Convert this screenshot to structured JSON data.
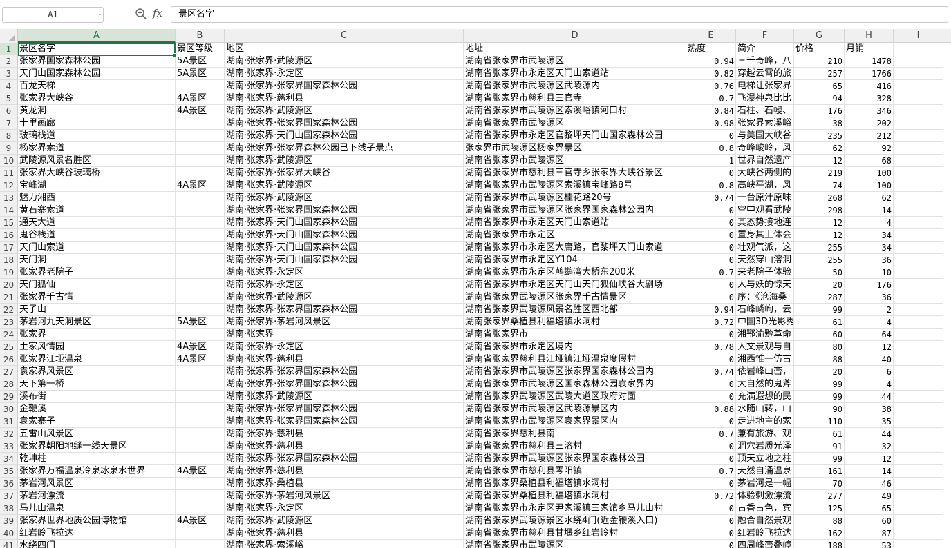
{
  "name_box": "A1",
  "formula_bar": {
    "fx_label": "fx",
    "value": "景区名字"
  },
  "columns": [
    "A",
    "B",
    "C",
    "D",
    "E",
    "F",
    "G",
    "H",
    "I"
  ],
  "selected_column": "A",
  "rows": [
    {
      "n": "1",
      "a": "景区名字",
      "b": "景区等级",
      "c": "地区",
      "d": "地址",
      "e": "热度",
      "f": "简介",
      "g": "价格",
      "h": "月销"
    },
    {
      "n": "2",
      "a": "张家界国家森林公园",
      "b": "5A景区",
      "c": "湖南·张家界·武陵源区",
      "d": "湖南省张家界市武陵源区",
      "e": "0.94",
      "f": "三千奇峰，八",
      "g": "210",
      "h": "1478"
    },
    {
      "n": "3",
      "a": "天门山国家森林公园",
      "b": "5A景区",
      "c": "湖南·张家界·永定区",
      "d": "湖南省张家界市永定区天门山索道站",
      "e": "0.82",
      "f": "穿越云霄的旅",
      "g": "257",
      "h": "1766"
    },
    {
      "n": "4",
      "a": "百龙天梯",
      "b": "",
      "c": "湖南·张家界·张家界国家森林公园",
      "d": "湖南省张家界市武陵源区武陵源内",
      "e": "0.76",
      "f": "电梯让张家界",
      "g": "65",
      "h": "416"
    },
    {
      "n": "5",
      "a": "张家界大峡谷",
      "b": "4A景区",
      "c": "湖南·张家界·慈利县",
      "d": "湖南省张家界市慈利县三官寺",
      "e": "0.7",
      "f": "飞瀑神泉比比",
      "g": "94",
      "h": "328"
    },
    {
      "n": "6",
      "a": "黄龙洞",
      "b": "4A景区",
      "c": "湖南·张家界·武陵源区",
      "d": "湖南省张家界市武陵源区索溪峪镇河口村",
      "e": "0.84",
      "f": "石柱、石幔、",
      "g": "176",
      "h": "346"
    },
    {
      "n": "7",
      "a": "十里画廊",
      "b": "",
      "c": "湖南·张家界·张家界国家森林公园",
      "d": "湖南省张家界市武陵源区",
      "e": "0.98",
      "f": "张家界索溪峪",
      "g": "38",
      "h": "202"
    },
    {
      "n": "8",
      "a": "玻璃栈道",
      "b": "",
      "c": "湖南·张家界·天门山国家森林公园",
      "d": "湖南省张家界市永定区官黎坪天门山国家森林公园",
      "e": "0",
      "f": "与美国大峡谷",
      "g": "235",
      "h": "212"
    },
    {
      "n": "9",
      "a": "杨家界索道",
      "b": "",
      "c": "湖南·张家界·张家界森林公园已下线子景点",
      "d": "张家界市武陵源区杨家界景区",
      "e": "0.8",
      "f": "奇峰峻岭，风",
      "g": "62",
      "h": "92"
    },
    {
      "n": "10",
      "a": "武陵源风景名胜区",
      "b": "",
      "c": "湖南·张家界·武陵源区",
      "d": "湖南省张家界市武陵源区",
      "e": "1",
      "f": "世界自然遗产",
      "g": "12",
      "h": "68"
    },
    {
      "n": "11",
      "a": "张家界大峡谷玻璃桥",
      "b": "",
      "c": "湖南·张家界·张家界大峡谷",
      "d": "湖南省张家界市慈利县三官寺乡张家界大峡谷景区",
      "e": "0",
      "f": "大峡谷两侧的",
      "g": "219",
      "h": "100"
    },
    {
      "n": "12",
      "a": "宝峰湖",
      "b": "4A景区",
      "c": "湖南·张家界·武陵源区",
      "d": "湖南省张家界市武陵源区索溪镇宝峰路8号",
      "e": "0.8",
      "f": "高峡平湖，风",
      "g": "74",
      "h": "100"
    },
    {
      "n": "13",
      "a": "魅力湘西",
      "b": "",
      "c": "湖南·张家界·武陵源区",
      "d": "湖南省张家界市武陵源区桂花路20号",
      "e": "0.74",
      "f": "一台原汁原味",
      "g": "268",
      "h": "62"
    },
    {
      "n": "14",
      "a": "黄石寨索道",
      "b": "",
      "c": "湖南·张家界·张家界国家森林公园",
      "d": "湖南省张家界市武陵源区张家界国家森林公园内",
      "e": "0",
      "f": "空中观看武陵",
      "g": "298",
      "h": "14"
    },
    {
      "n": "15",
      "a": "通天大道",
      "b": "",
      "c": "湖南·张家界·天门山国家森林公园",
      "d": "湖南省张家界市永定区天门山索道站",
      "e": "0",
      "f": "其态势接地连",
      "g": "12",
      "h": "4"
    },
    {
      "n": "16",
      "a": "鬼谷栈道",
      "b": "",
      "c": "湖南·张家界·天门山国家森林公园",
      "d": "湖南省张家界市永定区",
      "e": "0",
      "f": "置身其上体会",
      "g": "12",
      "h": "34"
    },
    {
      "n": "17",
      "a": "天门山索道",
      "b": "",
      "c": "湖南·张家界·天门山国家森林公园",
      "d": "湖南省张家界市永定区大庸路，官黎坪天门山索道",
      "e": "0",
      "f": "壮观气派，这",
      "g": "255",
      "h": "34"
    },
    {
      "n": "18",
      "a": "天门洞",
      "b": "",
      "c": "湖南·张家界·天门山国家森林公园",
      "d": "湖南省张家界市永定区Y104",
      "e": "0",
      "f": "天然穿山溶洞",
      "g": "255",
      "h": "36"
    },
    {
      "n": "19",
      "a": "张家界老院子",
      "b": "",
      "c": "湖南·张家界·永定区",
      "d": "湖南省张家界市永定区鸬鹚湾大桥东200米",
      "e": "0.7",
      "f": "来老院子体验",
      "g": "50",
      "h": "10"
    },
    {
      "n": "20",
      "a": "天门狐仙",
      "b": "",
      "c": "湖南·张家界·永定区",
      "d": "湖南省张家界市永定区天门山天门狐仙峡谷大剧场",
      "e": "0",
      "f": "人与妖的惊天",
      "g": "20",
      "h": "176"
    },
    {
      "n": "21",
      "a": "张家界千古情",
      "b": "",
      "c": "湖南·张家界·武陵源区",
      "d": "湖南省张家界武陵源区张家界千古情景区",
      "e": "0",
      "f": "序：《沧海桑",
      "g": "287",
      "h": "36"
    },
    {
      "n": "22",
      "a": "天子山",
      "b": "",
      "c": "湖南·张家界·张家界国家森林公园",
      "d": "湖南省张家界武陵源风景名胜区西北部",
      "e": "0.94",
      "f": "石峰嶙峋，云",
      "g": "99",
      "h": "2"
    },
    {
      "n": "23",
      "a": "茅岩河九天洞景区",
      "b": "5A景区",
      "c": "湖南·张家界·茅岩河风景区",
      "d": "湖南张家界桑植县利福塔镇水洞村",
      "e": "0.72",
      "f": "中国3D光影秀",
      "g": "61",
      "h": "4"
    },
    {
      "n": "24",
      "a": "张家界",
      "b": "",
      "c": "湖南·张家界",
      "d": "湖南省张家界市",
      "e": "0",
      "f": "湘鄂渝黔革命",
      "g": "60",
      "h": "64"
    },
    {
      "n": "25",
      "a": "土家风情园",
      "b": "4A景区",
      "c": "湖南·张家界·永定区",
      "d": "湖南省张家界市永定区境内",
      "e": "0.78",
      "f": "人文景观与自",
      "g": "80",
      "h": "12"
    },
    {
      "n": "26",
      "a": "张家界江垭温泉",
      "b": "4A景区",
      "c": "湖南·张家界·慈利县",
      "d": "湖南省张家界慈利县江垭镇江垭温泉度假村",
      "e": "0",
      "f": "湘西惟一仿古",
      "g": "88",
      "h": "40"
    },
    {
      "n": "27",
      "a": "袁家界风景区",
      "b": "",
      "c": "湖南·张家界·张家界国家森林公园",
      "d": "湖南省张家界市武陵源区张家界国家森林公园内",
      "e": "0.74",
      "f": "依岩峰山峦，",
      "g": "20",
      "h": "6"
    },
    {
      "n": "28",
      "a": "天下第一桥",
      "b": "",
      "c": "湖南·张家界·张家界国家森林公园",
      "d": "湖南省张家界市武陵源区国家森林公园袁家界内",
      "e": "0",
      "f": "大自然的鬼斧",
      "g": "99",
      "h": "4"
    },
    {
      "n": "29",
      "a": "溪布街",
      "b": "",
      "c": "湖南·张家界·武陵源区",
      "d": "湖南省张家界武陵源区武陵大道区政府对面",
      "e": "0",
      "f": "充满遐想的民",
      "g": "99",
      "h": "44"
    },
    {
      "n": "30",
      "a": "金鞭溪",
      "b": "",
      "c": "湖南·张家界·张家界国家森林公园",
      "d": "湖南省张家界市武陵源区武陵源景区内",
      "e": "0.88",
      "f": "水随山转，山",
      "g": "90",
      "h": "38"
    },
    {
      "n": "31",
      "a": "袁家寨子",
      "b": "",
      "c": "湖南·张家界·张家界国家森林公园",
      "d": "湖南省张家界市武陵源区袁家界景区内",
      "e": "0",
      "f": "走进地主的家",
      "g": "110",
      "h": "35"
    },
    {
      "n": "32",
      "a": "五雷山风景区",
      "b": "",
      "c": "湖南·张家界·慈利县",
      "d": "湖南省张家界慈利县南",
      "e": "0.7",
      "f": "兼有旅游、观",
      "g": "61",
      "h": "44"
    },
    {
      "n": "33",
      "a": "张家界朝阳地缝一线天景区",
      "b": "",
      "c": "湖南·张家界·慈利县",
      "d": "湖南省张家界市慈利县三溶村",
      "e": "0",
      "f": "洞穴岩质光泽",
      "g": "91",
      "h": "32"
    },
    {
      "n": "34",
      "a": "乾坤柱",
      "b": "",
      "c": "湖南·张家界·张家界国家森林公园",
      "d": "湖南省张家界市武陵源区张家界国家森林公园",
      "e": "0",
      "f": "顶天立地之柱",
      "g": "99",
      "h": "12"
    },
    {
      "n": "35",
      "a": "张家界万福温泉冷泉冰泉水世界",
      "b": "4A景区",
      "c": "湖南·张家界·慈利县",
      "d": "湖南省张家界市慈利县零阳镇",
      "e": "0.7",
      "f": "天然自涌温泉",
      "g": "161",
      "h": "14"
    },
    {
      "n": "36",
      "a": "茅岩河风景区",
      "b": "",
      "c": "湖南·张家界·桑植县",
      "d": "湖南省张家界桑植县利福塔镇水洞村",
      "e": "0",
      "f": "茅岩河是一幅",
      "g": "70",
      "h": "46"
    },
    {
      "n": "37",
      "a": "茅岩河漂流",
      "b": "",
      "c": "湖南·张家界·茅岩河风景区",
      "d": "湖南省张家界桑植县利福塔镇水洞村",
      "e": "0.72",
      "f": "体验刺激漂流",
      "g": "277",
      "h": "49"
    },
    {
      "n": "38",
      "a": "马儿山温泉",
      "b": "",
      "c": "湖南·张家界·永定区",
      "d": "湖南省张家界市永定区尹家溪镇三家馆乡马儿山村",
      "e": "0",
      "f": "古香古色，宾",
      "g": "125",
      "h": "65"
    },
    {
      "n": "39",
      "a": "张家界世界地质公园博物馆",
      "b": "4A景区",
      "c": "湖南·张家界·武陵源区",
      "d": "湖南省张家界武陵源景区水绕4门(近金鞭溪入口)",
      "e": "0",
      "f": "融合自然景观",
      "g": "88",
      "h": "60"
    },
    {
      "n": "40",
      "a": "红岩岭飞拉达",
      "b": "",
      "c": "湖南·张家界·慈利县",
      "d": "湖南省张家界市慈利县甘堰乡红岩岭村",
      "e": "0",
      "f": "红岩岭飞拉达",
      "g": "162",
      "h": "87"
    },
    {
      "n": "41",
      "a": "水绕四门",
      "b": "",
      "c": "湖南·张家界·索溪峪",
      "d": "湖南省张家界市武陵源区",
      "e": "0",
      "f": "四周峰峦叠嶂",
      "g": "188",
      "h": "53"
    }
  ]
}
